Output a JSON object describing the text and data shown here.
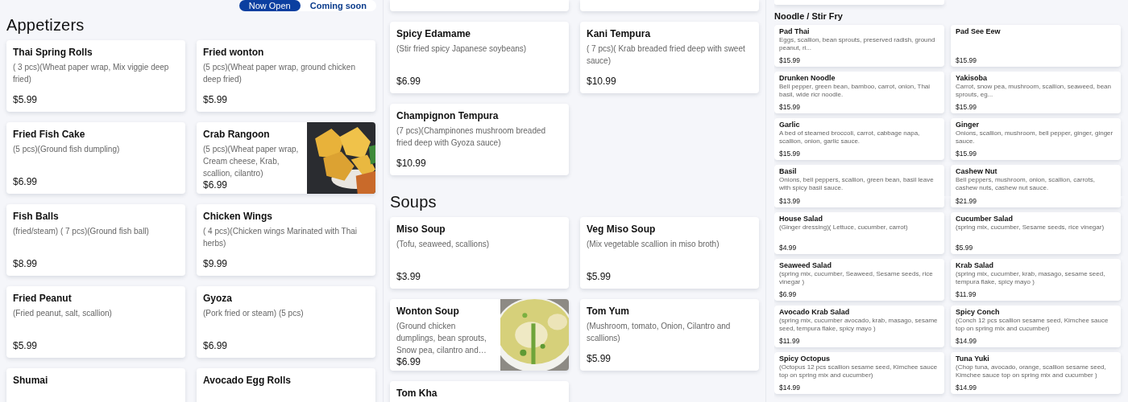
{
  "status_toggle": [
    {
      "label": "Now Open",
      "selected": true
    },
    {
      "label": "Coming soon",
      "selected": false
    }
  ],
  "panels": [
    {
      "kind": "large",
      "segments": [
        {
          "blocks": [
            {
              "kind": "heading",
              "text": "Appetizers"
            },
            {
              "kind": "cards",
              "items": [
                {
                  "name": "Thai Spring Rolls",
                  "description": "( 3 pcs)(Wheat paper wrap, Mix viggie deep fried)",
                  "price": "$5.99"
                },
                {
                  "name": "Fried wonton",
                  "description": "(5 pcs)(Wheat paper wrap, ground chicken deep fried)",
                  "price": "$5.99"
                },
                {
                  "name": "Fried Fish Cake",
                  "description": "(5 pcs)(Ground fish dumpling)",
                  "price": "$6.99"
                },
                {
                  "name": "Crab Rangoon",
                  "description": "(5 pcs)(Wheat paper wrap, Cream cheese, Krab, scallion, cilantro)",
                  "price": "$6.99",
                  "photo": true
                },
                {
                  "name": "Fish Balls",
                  "description": "(fried/steam) ( 7 pcs)(Ground fish ball)",
                  "price": "$8.99"
                },
                {
                  "name": "Chicken Wings",
                  "description": "( 4 pcs)(Chicken wings Marinated with Thai herbs)",
                  "price": "$9.99"
                },
                {
                  "name": "Fried Peanut",
                  "description": "(Fried peanut, salt, scallion)",
                  "price": "$5.99"
                },
                {
                  "name": "Gyoza",
                  "description": "(Pork fried or steam) (5 pcs)",
                  "price": "$6.99"
                },
                {
                  "name": "Shumai"
                },
                {
                  "name": "Avocado Egg Rolls"
                }
              ]
            }
          ]
        }
      ]
    },
    {
      "kind": "large",
      "segments": [
        {
          "blocks": [
            {
              "kind": "cards",
              "items": [
                {
                  "cut": true
                },
                {
                  "cut": true
                },
                {
                  "name": "Spicy Edamame",
                  "description": "(Stir fried spicy Japanese soybeans)",
                  "price": "$6.99"
                },
                {
                  "name": "Kani Tempura",
                  "description": "( 7 pcs)( Krab breaded fried deep with sweet sauce)",
                  "price": "$10.99"
                },
                {
                  "name": "Champignon Tempura",
                  "description": "(7 pcs)(Champinones mushroom breaded fried deep with Gyoza sauce)",
                  "price": "$10.99"
                }
              ]
            },
            {
              "kind": "heading",
              "text": "Soups"
            },
            {
              "kind": "cards",
              "items": [
                {
                  "name": "Miso Soup",
                  "description": "(Tofu, seaweed, scallions)",
                  "price": "$3.99"
                },
                {
                  "name": "Veg Miso Soup",
                  "description": "(Mix vegetable scallion in miso broth)",
                  "price": "$5.99"
                },
                {
                  "name": "Wonton Soup",
                  "description": "(Ground chicken dumplings, bean sprouts, Snow pea, cilantro and…",
                  "price": "$6.99",
                  "photo": true
                },
                {
                  "name": "Tom Yum",
                  "description": "(Mushroom, tomato, Onion, Cilantro and scallions)",
                  "price": "$5.99"
                },
                {
                  "name": "Tom Kha"
                }
              ]
            }
          ]
        }
      ]
    },
    {
      "kind": "small",
      "segments": [
        {
          "blocks": [
            {
              "kind": "cards",
              "items": [
                {
                  "cut": true
                }
              ]
            },
            {
              "kind": "heading",
              "text": "Noodle / Stir Fry"
            },
            {
              "kind": "cards",
              "items": [
                {
                  "name": "Pad Thai",
                  "description": "Eggs, scallion, bean sprouts, preserved radish, ground peanut, ri...",
                  "price": "$15.99"
                },
                {
                  "name": "Pad See Eew",
                  "price": "$15.99"
                },
                {
                  "name": "Drunken Noodle",
                  "description": "Bell pepper, green bean, bamboo, carrot, onion, Thai basil, wide ricr noodle.",
                  "price": "$15.99"
                },
                {
                  "name": "Yakisoba",
                  "description": "Carrot, snow pea, mushroom, scallion, seaweed, bean sprouts, eg...",
                  "price": "$15.99"
                },
                {
                  "name": "Garlic",
                  "description": "A bed of steamed broccoli, carrot, cabbage napa, scallion, onion, garlic sauce.",
                  "price": "$15.99"
                },
                {
                  "name": "Ginger",
                  "description": "Onions, scallion, mushroom, bell pepper, ginger, ginger sauce.",
                  "price": "$15.99"
                },
                {
                  "name": "Basil",
                  "description": "Onions, bell peppers, scallion, green bean, basil leave with spicy basil sauce."
                },
                {
                  "name": "Cashew Nut",
                  "description": "Bell peppers, mushroom, onion, scallion, carrots, cashew nuts, cashew nut sauce."
                }
              ]
            }
          ]
        },
        {
          "blocks": [
            {
              "kind": "cards",
              "items": [
                {
                  "cut": true,
                  "price": "$13.99"
                },
                {
                  "cut": true,
                  "price": "$21.99"
                },
                {
                  "name": "House Salad",
                  "description": "(Ginger dressing)( Lettuce, cucumber, carrot)",
                  "price": "$4.99"
                },
                {
                  "name": "Cucumber Salad",
                  "description": "(spring mix, cucumber, Sesame seeds, rice vinegar)",
                  "price": "$5.99"
                },
                {
                  "name": "Seaweed Salad",
                  "description": "(spring mix, cucumber, Seaweed, Sesame seeds, rice vinegar )",
                  "price": "$6.99"
                },
                {
                  "name": "Krab Salad",
                  "description": "(spring mix, cucumber, krab, masago, sesame seed, tempura flake, spicy mayo )",
                  "price": "$11.99"
                },
                {
                  "name": "Avocado Krab Salad",
                  "description": "(spring mix, cucumber avocado, krab, masago, sesame seed, tempura flake, spicy mayo )",
                  "price": "$11.99"
                },
                {
                  "name": "Spicy Conch",
                  "description": "(Conch 12 pcs scallion sesame seed, Kimchee sauce top on spring mix and cucumber)",
                  "price": "$14.99"
                },
                {
                  "name": "Spicy Octopus",
                  "description": "(Octopus 12 pcs scallion sesame seed, Kimchee sauce top on spring mix and cucumber)",
                  "price": "$14.99"
                },
                {
                  "name": "Tuna Yuki",
                  "description": "(Chop tuna, avocado, orange, scallion sesame seed, Kimchee sauce top on spring mix and cucumber )",
                  "price": "$14.99"
                }
              ]
            }
          ]
        }
      ]
    }
  ]
}
